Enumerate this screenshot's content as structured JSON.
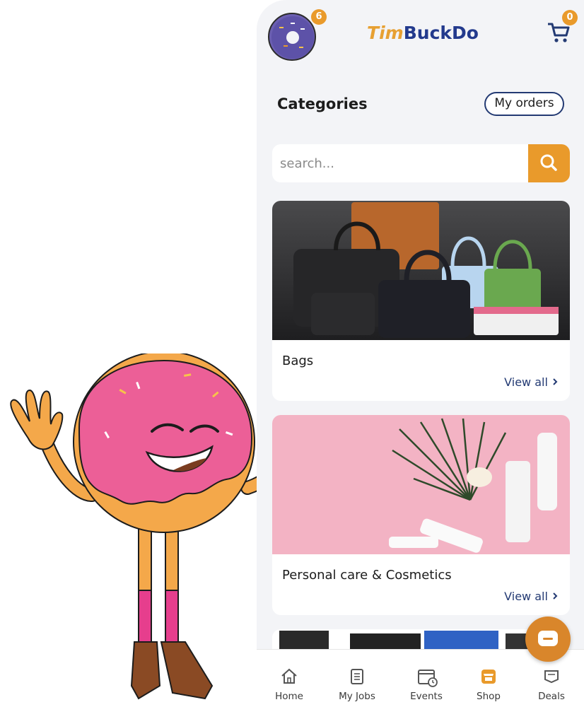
{
  "header": {
    "logo_part1": "Tim",
    "logo_part2": "BuckDo",
    "avatar_badge": "6",
    "cart_badge": "0"
  },
  "categories": {
    "title": "Categories",
    "my_orders_label": "My orders"
  },
  "search": {
    "placeholder": "search..."
  },
  "cards": [
    {
      "name": "Bags",
      "view_all": "View all"
    },
    {
      "name": "Personal care & Cosmetics",
      "view_all": "View all"
    }
  ],
  "tabs": [
    {
      "label": "Home",
      "icon": "home-icon"
    },
    {
      "label": "My Jobs",
      "icon": "clipboard-icon"
    },
    {
      "label": "Events",
      "icon": "calendar-icon"
    },
    {
      "label": "Shop",
      "icon": "shop-icon"
    },
    {
      "label": "Deals",
      "icon": "deals-icon"
    }
  ],
  "colors": {
    "accent": "#e99a2b",
    "brand_blue": "#233a8d",
    "mascot_icing": "#ec5f97",
    "mascot_dough": "#f4a84a"
  }
}
